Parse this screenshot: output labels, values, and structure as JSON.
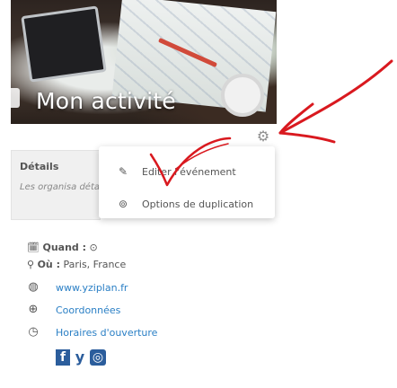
{
  "hero": {
    "title": "Mon activité"
  },
  "details": {
    "heading": "Détails",
    "description": "Les organisa détail"
  },
  "menu": {
    "edit_label": "Editer l'événement",
    "duplicate_label": "Options de duplication"
  },
  "info": {
    "when_label": "Quand :",
    "where_label": "Où :",
    "where_value": "Paris, France"
  },
  "links": [
    {
      "label": "www.yziplan.fr",
      "icon": "globe-icon"
    },
    {
      "label": "Coordonnées",
      "icon": "contact-icon"
    },
    {
      "label": "Horaires d'ouverture",
      "icon": "clock-icon"
    }
  ],
  "social": {
    "facebook": "f",
    "twitter": "y",
    "instagram": "◎"
  },
  "colors": {
    "link": "#2a7fc5",
    "annotation": "#d9191f",
    "social": "#2b5d9c"
  }
}
